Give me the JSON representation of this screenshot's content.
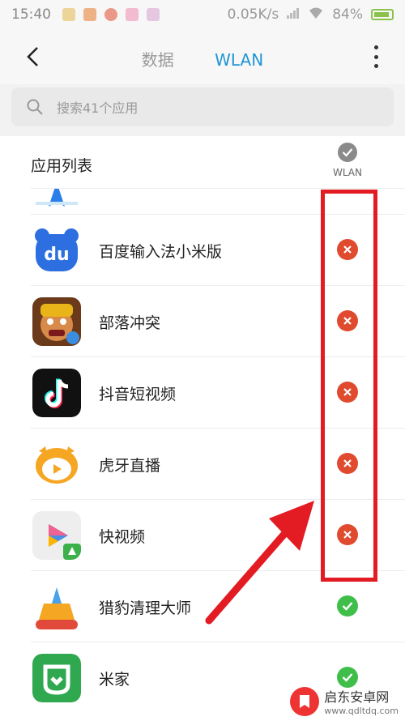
{
  "status": {
    "time": "15:40",
    "speed": "0.05K/s",
    "battery": "84%"
  },
  "nav": {
    "tabs": [
      {
        "label": "数据",
        "active": false
      },
      {
        "label": "WLAN",
        "active": true
      }
    ]
  },
  "search": {
    "placeholder": "搜索41个应用"
  },
  "list": {
    "header": "应用列表",
    "column_label": "WLAN",
    "apps": [
      {
        "name": "百度输入法小米版",
        "wlan": "blocked"
      },
      {
        "name": "部落冲突",
        "wlan": "blocked"
      },
      {
        "name": "抖音短视频",
        "wlan": "blocked"
      },
      {
        "name": "虎牙直播",
        "wlan": "blocked"
      },
      {
        "name": "快视频",
        "wlan": "blocked"
      },
      {
        "name": "猎豹清理大师",
        "wlan": "allowed"
      },
      {
        "name": "米家",
        "wlan": "allowed"
      }
    ]
  },
  "watermark": {
    "name": "启东安卓网",
    "url": "www.qdltdq.com"
  },
  "colors": {
    "accent": "#2196d4",
    "blocked": "#e04a2e",
    "allowed": "#3fbf4a",
    "highlight": "#e31b23"
  }
}
